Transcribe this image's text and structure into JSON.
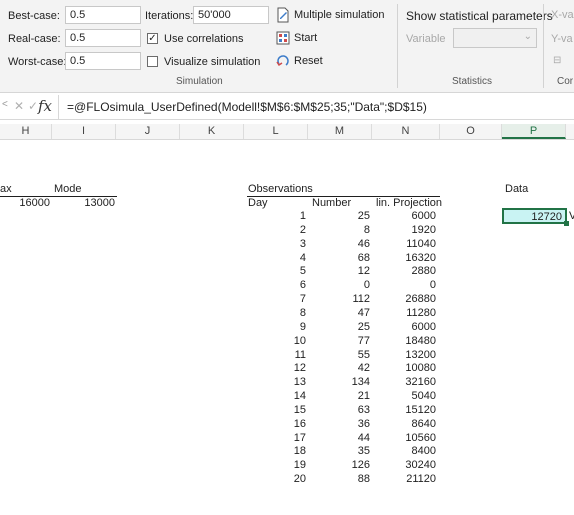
{
  "ribbon": {
    "best_case_label": "Best-case:",
    "best_case_value": "0.5",
    "real_case_label": "Real-case:",
    "real_case_value": "0.5",
    "worst_case_label": "Worst-case:",
    "worst_case_value": "0.5",
    "iterations_label": "Iterations:",
    "iterations_value": "50'000",
    "use_correlations_label": "Use correlations",
    "use_correlations_checked": true,
    "visualize_simulation_label": "Visualize simulation",
    "visualize_simulation_checked": false,
    "multiple_simulation_label": "Multiple simulation",
    "start_label": "Start",
    "reset_label": "Reset",
    "simulation_group_label": "Simulation",
    "show_statistical_label": "Show statistical parameters",
    "variable_label": "Variable",
    "statistics_group_label": "Statistics",
    "x_var_label": "X-va",
    "y_var_label": "Y-va",
    "cor_group_label": "Cor"
  },
  "formula_bar": {
    "cancel_glyph": "✕",
    "confirm_glyph": "✓",
    "fx_label": "fx",
    "formula": "=@FLOsimula_UserDefined(Modell!$M$6:$M$25;35;\"Data\";$D$15)"
  },
  "columns": [
    "H",
    "I",
    "J",
    "K",
    "L",
    "M",
    "N",
    "O",
    "P"
  ],
  "sheet": {
    "max_header": "ax",
    "mode_header": "Mode",
    "max_value": "16000",
    "mode_value": "13000",
    "observations_title": "Observations",
    "day_header": "Day",
    "number_header": "Number",
    "projection_header": "lin. Projection",
    "data_header": "Data",
    "data_value": "12720",
    "data_side_text": "V",
    "rows": [
      {
        "day": "1",
        "number": "25",
        "projection": "6000"
      },
      {
        "day": "2",
        "number": "8",
        "projection": "1920"
      },
      {
        "day": "3",
        "number": "46",
        "projection": "11040"
      },
      {
        "day": "4",
        "number": "68",
        "projection": "16320"
      },
      {
        "day": "5",
        "number": "12",
        "projection": "2880"
      },
      {
        "day": "6",
        "number": "0",
        "projection": "0"
      },
      {
        "day": "7",
        "number": "112",
        "projection": "26880"
      },
      {
        "day": "8",
        "number": "47",
        "projection": "11280"
      },
      {
        "day": "9",
        "number": "25",
        "projection": "6000"
      },
      {
        "day": "10",
        "number": "77",
        "projection": "18480"
      },
      {
        "day": "11",
        "number": "55",
        "projection": "13200"
      },
      {
        "day": "12",
        "number": "42",
        "projection": "10080"
      },
      {
        "day": "13",
        "number": "134",
        "projection": "32160"
      },
      {
        "day": "14",
        "number": "21",
        "projection": "5040"
      },
      {
        "day": "15",
        "number": "63",
        "projection": "15120"
      },
      {
        "day": "16",
        "number": "36",
        "projection": "8640"
      },
      {
        "day": "17",
        "number": "44",
        "projection": "10560"
      },
      {
        "day": "18",
        "number": "35",
        "projection": "8400"
      },
      {
        "day": "19",
        "number": "126",
        "projection": "30240"
      },
      {
        "day": "20",
        "number": "88",
        "projection": "21120"
      }
    ]
  }
}
